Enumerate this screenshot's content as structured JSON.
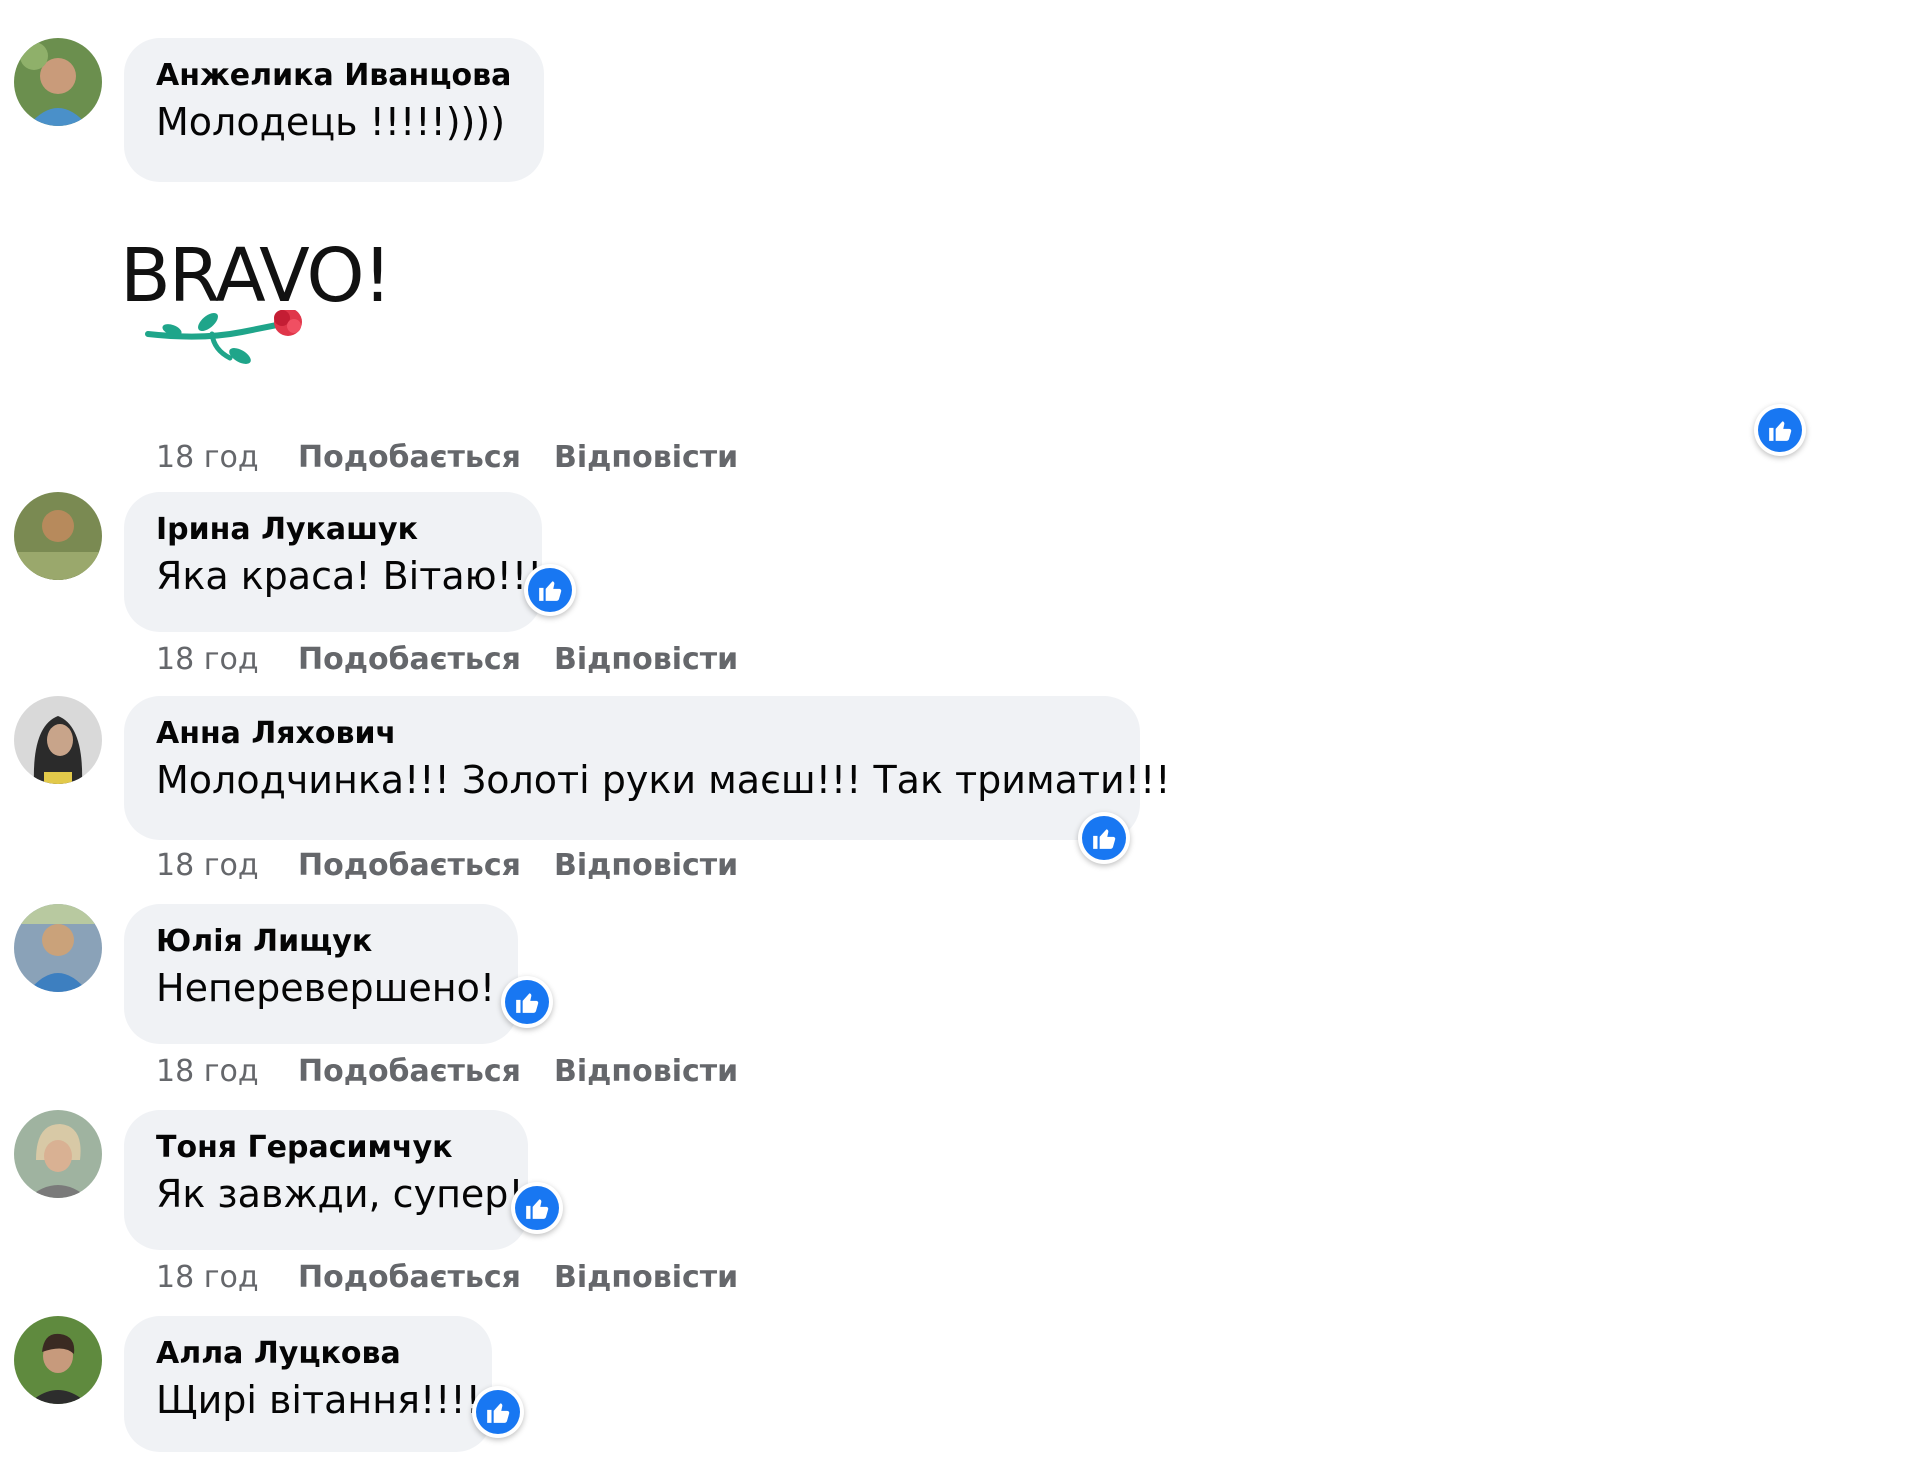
{
  "comments": [
    {
      "author": "Анжелика Иванцова",
      "text": "Молодець !!!!!))))",
      "sticker_text": "BRAVO!",
      "time": "18 год",
      "like": "Подобається",
      "reply": "Відповісти",
      "reaction": "like-icon"
    },
    {
      "author": "Ірина Лукашук",
      "text": "Яка краса! Вітаю!!!",
      "time": "18 год",
      "like": "Подобається",
      "reply": "Відповісти",
      "reaction": "like-icon"
    },
    {
      "author": "Анна Ляхович",
      "text": "Молодчинка!!! Золоті руки маєш!!! Так тримати!!!",
      "time": "18 год",
      "like": "Подобається",
      "reply": "Відповісти",
      "reaction": "like-icon"
    },
    {
      "author": "Юлія Лищук",
      "text": "Неперевершено!",
      "time": "18 год",
      "like": "Подобається",
      "reply": "Відповісти",
      "reaction": "like-icon"
    },
    {
      "author": "Тоня Герасимчук",
      "text": "Як завжди, супер!",
      "time": "18 год",
      "like": "Подобається",
      "reply": "Відповісти",
      "reaction": "like-icon"
    },
    {
      "author": "Алла Луцкова",
      "text": "Щирі вітання!!!!",
      "reaction": "like-icon"
    }
  ],
  "colors": {
    "bubble": "#f0f2f5",
    "like_blue": "#1877f2",
    "meta_gray": "#65676b"
  }
}
